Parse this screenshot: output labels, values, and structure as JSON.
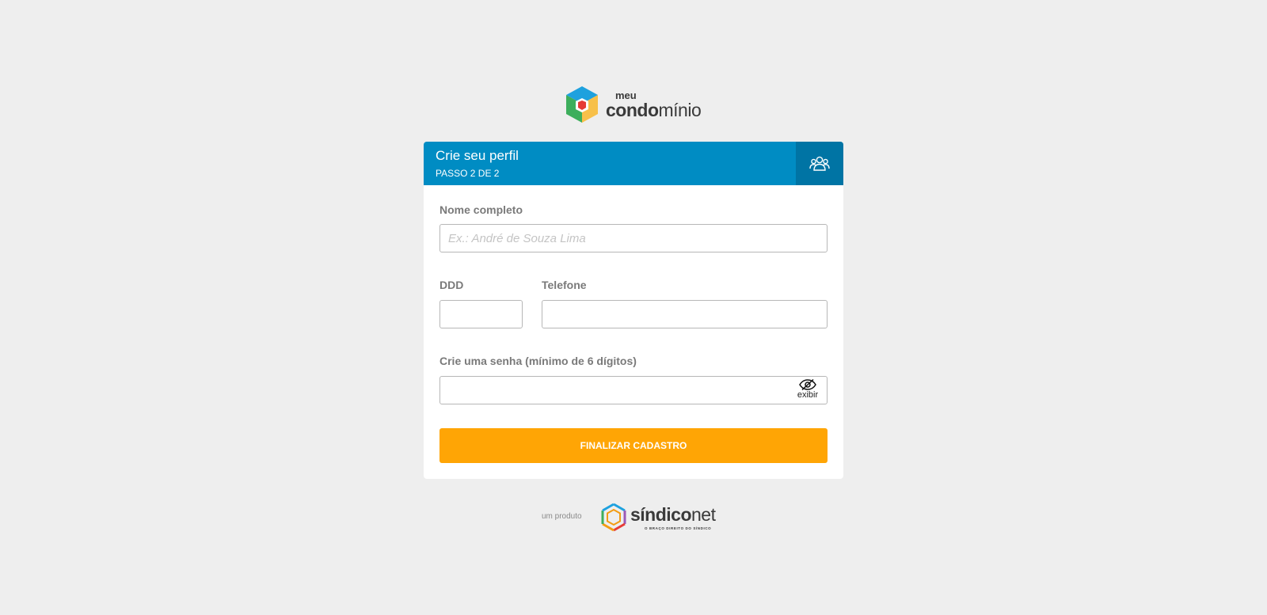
{
  "logo": {
    "small_text": "meu",
    "big_bold": "condo",
    "big_regular": "mínio"
  },
  "card": {
    "title": "Crie seu perfil",
    "subtitle": "PASSO 2 DE 2",
    "header_icon": "users-icon"
  },
  "form": {
    "name_label": "Nome completo",
    "name_placeholder": "Ex.: André de Souza Lima",
    "name_value": "",
    "ddd_label": "DDD",
    "ddd_value": "",
    "phone_label": "Telefone",
    "phone_value": "",
    "password_label": "Crie uma senha (mínimo de 6 dígitos)",
    "password_value": "",
    "show_password_icon": "eye-slash-icon",
    "show_password_label": "exibir",
    "submit_label": "FINALIZAR CADASTRO"
  },
  "footer": {
    "product_text": "um produto",
    "brand_bold": "síndico",
    "brand_regular": "net",
    "tagline": "O BRAÇO DIREITO DO SÍNDICO"
  },
  "colors": {
    "background": "#eeeeee",
    "header_blue": "#008cc3",
    "header_icon_blue": "#0074a4",
    "button_orange": "#ffa505"
  }
}
